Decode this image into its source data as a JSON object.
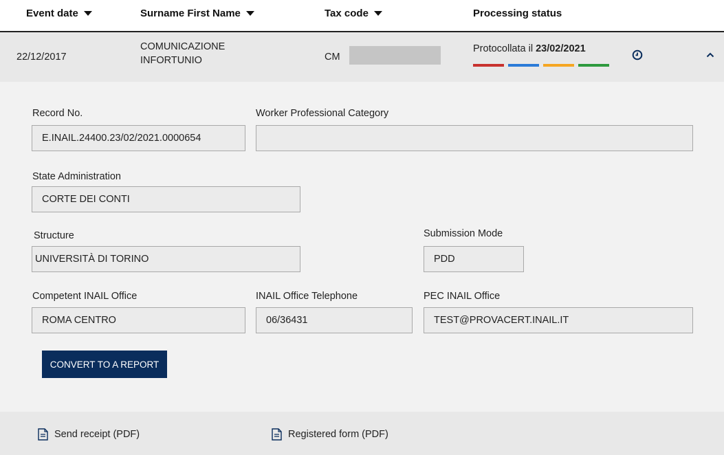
{
  "columns": {
    "event_date": "Event date",
    "name": "Surname First Name",
    "tax_code": "Tax code",
    "status": "Processing status"
  },
  "record": {
    "event_date": "22/12/2017",
    "name_line1": "COMUNICAZIONE",
    "name_line2": "INFORTUNIO",
    "tax_code_prefix": "CM",
    "status_prefix": "Protocollata il ",
    "status_date": "23/02/2021",
    "status_colors": [
      "#c8322f",
      "#2b7bd8",
      "#f5a623",
      "#2e9a3e"
    ]
  },
  "detail": {
    "record_no": {
      "label": "Record No.",
      "value": "E.INAIL.24400.23/02/2021.0000654"
    },
    "worker_category": {
      "label": "Worker Professional Category",
      "value": ""
    },
    "state_admin": {
      "label": "State Administration",
      "value": "CORTE DEI CONTI"
    },
    "structure": {
      "label": "Structure",
      "value": "UNIVERSITÀ DI TORINO"
    },
    "submission_mode": {
      "label": "Submission Mode",
      "value": "PDD"
    },
    "office": {
      "label": "Competent INAIL Office",
      "value": "ROMA CENTRO"
    },
    "telephone": {
      "label": "INAIL Office Telephone",
      "value": "06/36431"
    },
    "pec": {
      "label": "PEC INAIL Office",
      "value": "TEST@PROVACERT.INAIL.IT"
    },
    "convert_button": "CONVERT TO A REPORT"
  },
  "footer": {
    "send_receipt": "Send receipt (PDF)",
    "registered_form": "Registered form (PDF)"
  },
  "icons": {
    "sort": "triangle-down-icon",
    "history": "clock-icon",
    "collapse": "chevron-up-icon",
    "document": "document-icon"
  },
  "colors": {
    "accent": "#0a2d5c",
    "header_border": "#222222"
  }
}
